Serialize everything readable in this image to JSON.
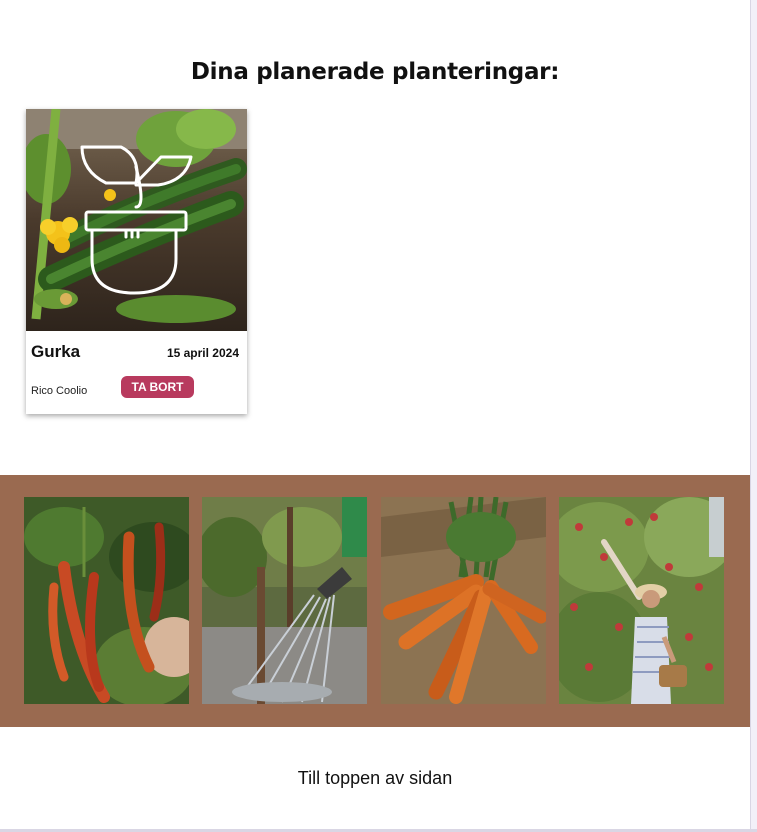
{
  "heading": "Dina planerade planteringar:",
  "planting": {
    "name": "Gurka",
    "date": "15 april 2024",
    "owner": "Rico Coolio",
    "remove_label": "TA BORT",
    "photo_icon": "cucumber-plant-photo",
    "overlay_icon": "potted-plant-icon"
  },
  "gallery": {
    "images": [
      "chili-peppers-photo",
      "watering-can-photo",
      "carrots-photo",
      "apple-picking-photo"
    ]
  },
  "footer": {
    "to_top_label": "Till toppen av sidan"
  },
  "colors": {
    "remove_button": "#b83a5e",
    "gallery_band": "#9a6a50"
  }
}
